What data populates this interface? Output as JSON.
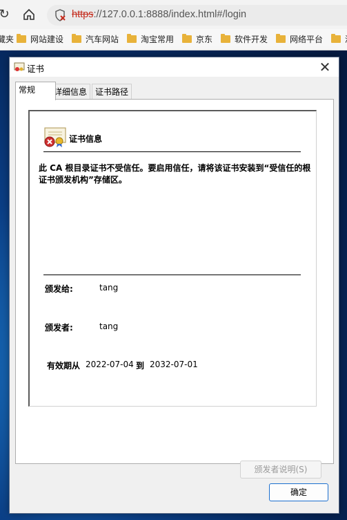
{
  "browser": {
    "url_protocol": "https",
    "url_rest": "://127.0.0.1:8888/index.html#/login",
    "bookmarks": [
      "藏夹",
      "网站建设",
      "汽车网站",
      "淘宝常用",
      "京东",
      "软件开发",
      "网络平台",
      "洲"
    ]
  },
  "dialog": {
    "title": "证书",
    "tabs": [
      "常规",
      "详细信息",
      "证书路径"
    ],
    "cert_heading": "证书信息",
    "warning": "此 CA 根目录证书不受信任。要启用信任，请将该证书安装到“受信任的根证书颁发机构”存储区。",
    "issued_to_label": "颁发给:",
    "issued_to": "tang",
    "issued_by_label": "颁发者:",
    "issued_by": "tang",
    "valid_label": "有效期从",
    "valid_from": "2022-07-04",
    "valid_to_label": "到",
    "valid_to": "2032-07-01",
    "issuer_statement_button": "颁发者说明(S)",
    "ok_button": "确定"
  }
}
